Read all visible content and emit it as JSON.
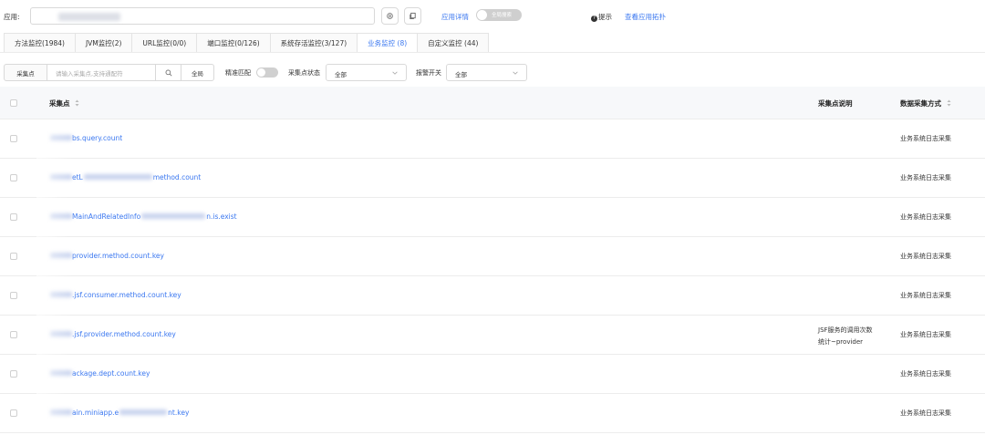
{
  "top": {
    "app_label": "应用:",
    "app_detail_link": "应用详情",
    "global_search_label": "全局搜索",
    "hint_text": "提示",
    "topology_link": "查看应用拓扑"
  },
  "tabs": [
    {
      "label": "方法监控(1984)",
      "active": false
    },
    {
      "label": "JVM监控(2)",
      "active": false
    },
    {
      "label": "URL监控(0/0)",
      "active": false
    },
    {
      "label": "端口监控(0/126)",
      "active": false
    },
    {
      "label": "系统存活监控(3/127)",
      "active": false
    },
    {
      "label": "业务监控 (8)",
      "active": true
    },
    {
      "label": "自定义监控 (44)",
      "active": false
    }
  ],
  "filters": {
    "field_label": "采集点",
    "search_placeholder": "请输入采集点,支持通配符",
    "global_button": "全局",
    "exact_match_label": "精准匹配",
    "status_label": "采集点状态",
    "status_value": "全部",
    "alarm_label": "报警开关",
    "alarm_value": "全部"
  },
  "table": {
    "columns": {
      "point": "采集点",
      "desc": "采集点说明",
      "mode": "数据采集方式"
    },
    "rows": [
      {
        "name": "bs.query.count",
        "desc": "",
        "mode": "业务系统日志采集"
      },
      {
        "name_a": "etL",
        "name_b": "method.count",
        "desc": "",
        "mode": "业务系统日志采集"
      },
      {
        "name_a": "MainAndRelatedInfo",
        "name_b": "n.is.exist",
        "desc": "",
        "mode": "业务系统日志采集"
      },
      {
        "name": "provider.method.count.key",
        "desc": "",
        "mode": "业务系统日志采集"
      },
      {
        "name": ".jsf.consumer.method.count.key",
        "desc": "",
        "mode": "业务系统日志采集"
      },
      {
        "name": ".jsf.provider.method.count.key",
        "desc_1": "JSF服务的调用次数",
        "desc_2": "统计~provider",
        "mode": "业务系统日志采集"
      },
      {
        "name": "ackage.dept.count.key",
        "desc": "",
        "mode": "业务系统日志采集"
      },
      {
        "name_a": "ain.miniapp.e",
        "name_b": "nt.key",
        "desc": "",
        "mode": "业务系统日志采集"
      }
    ]
  },
  "colors": {
    "accent": "#3a77f0",
    "border": "#d9d9d9",
    "header_bg": "#f7f8fa"
  }
}
